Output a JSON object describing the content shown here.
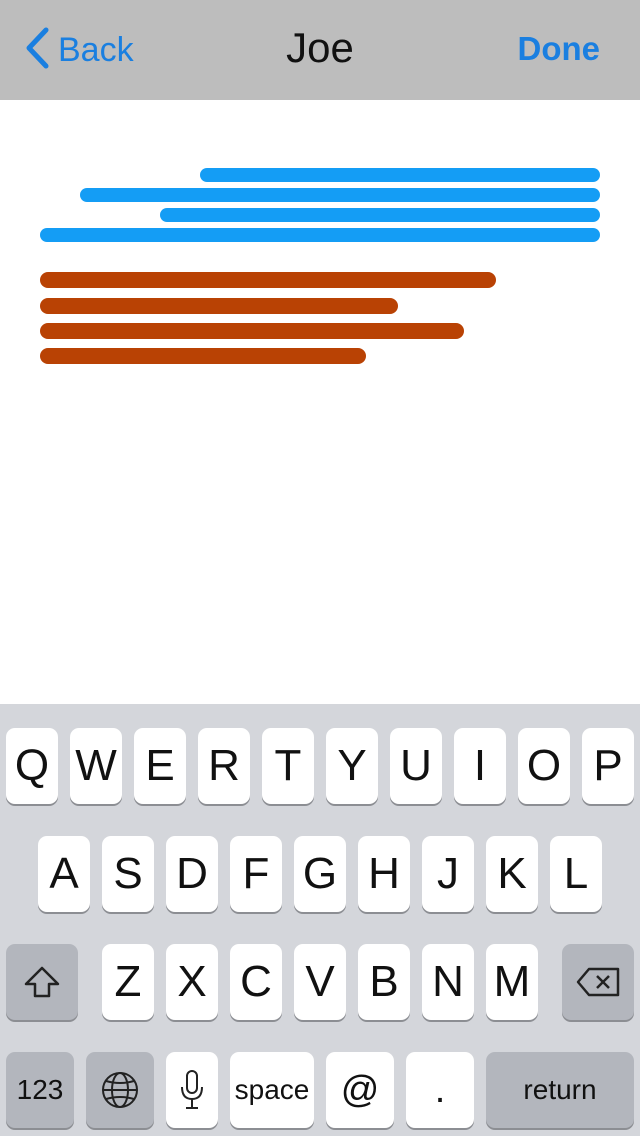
{
  "nav": {
    "back_label": "Back",
    "title": "Joe",
    "done_label": "Done"
  },
  "colors": {
    "accent": "#1a7fe0",
    "blue_bar": "#149df5",
    "orange_bar": "#b94204"
  },
  "keyboard": {
    "row1": [
      "Q",
      "W",
      "E",
      "R",
      "T",
      "Y",
      "U",
      "I",
      "O",
      "P"
    ],
    "row2": [
      "A",
      "S",
      "D",
      "F",
      "G",
      "H",
      "J",
      "K",
      "L"
    ],
    "row3": [
      "Z",
      "X",
      "C",
      "V",
      "B",
      "N",
      "M"
    ],
    "numbers_label": "123",
    "space_label": "space",
    "at_label": "@",
    "dot_label": ".",
    "return_label": "return",
    "icons": {
      "shift": "shift-icon",
      "delete": "delete-icon",
      "globe": "globe-icon",
      "mic": "microphone-icon"
    }
  }
}
